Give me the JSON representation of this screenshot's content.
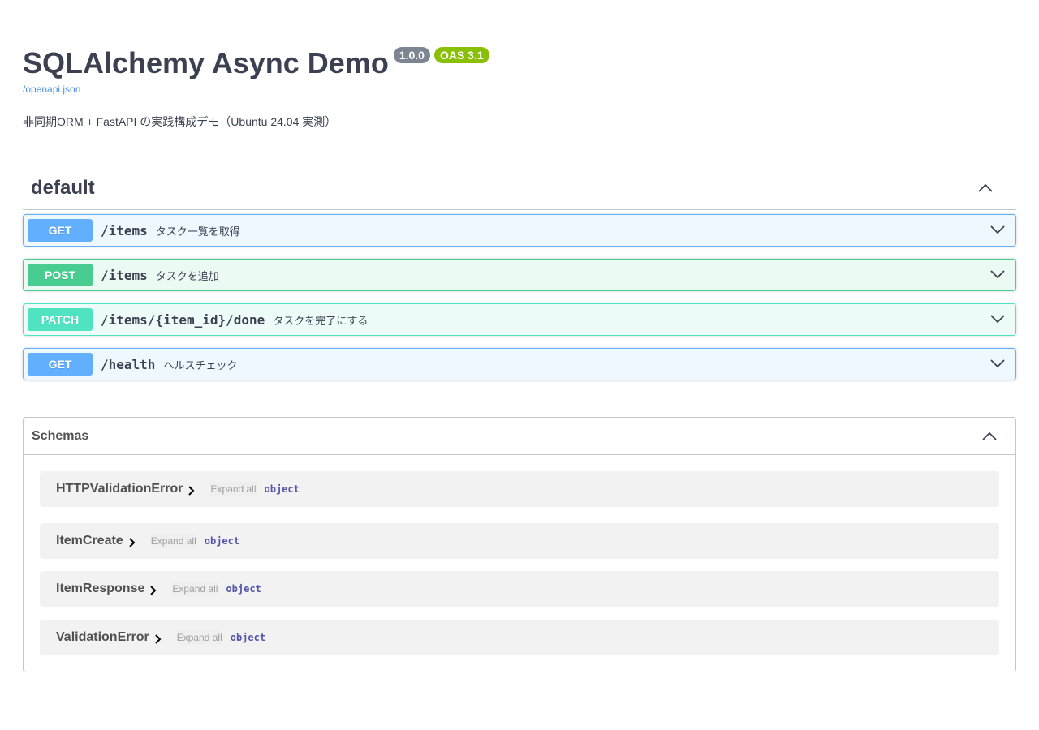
{
  "info": {
    "title": "SQLAlchemy Async Demo",
    "version": "1.0.0",
    "oas": "OAS 3.1",
    "spec_link": "/openapi.json",
    "description": "非同期ORM + FastAPI の実践構成デモ（Ubuntu 24.04 実測）"
  },
  "tag": {
    "name": "default",
    "expanded": true
  },
  "operations": [
    {
      "method": "GET",
      "path": "/items",
      "summary": "タスク一覧を取得",
      "color": "#61affe"
    },
    {
      "method": "POST",
      "path": "/items",
      "summary": "タスクを追加",
      "color": "#49cc90"
    },
    {
      "method": "PATCH",
      "path": "/items/{item_id}/done",
      "summary": "タスクを完了にする",
      "color": "#50e3c2"
    },
    {
      "method": "GET",
      "path": "/health",
      "summary": "ヘルスチェック",
      "color": "#61affe"
    }
  ],
  "schemas": {
    "title": "Schemas",
    "items": [
      {
        "name": "HTTPValidationError",
        "expand_all": "Expand all",
        "type": "object"
      },
      {
        "name": "ItemCreate",
        "expand_all": "Expand all",
        "type": "object"
      },
      {
        "name": "ItemResponse",
        "expand_all": "Expand all",
        "type": "object"
      },
      {
        "name": "ValidationError",
        "expand_all": "Expand all",
        "type": "object"
      }
    ]
  },
  "colors": {
    "text": "#3b4151",
    "link": "#4990e2",
    "version_badge": "#7d8492",
    "oas_badge": "#89bf04"
  }
}
